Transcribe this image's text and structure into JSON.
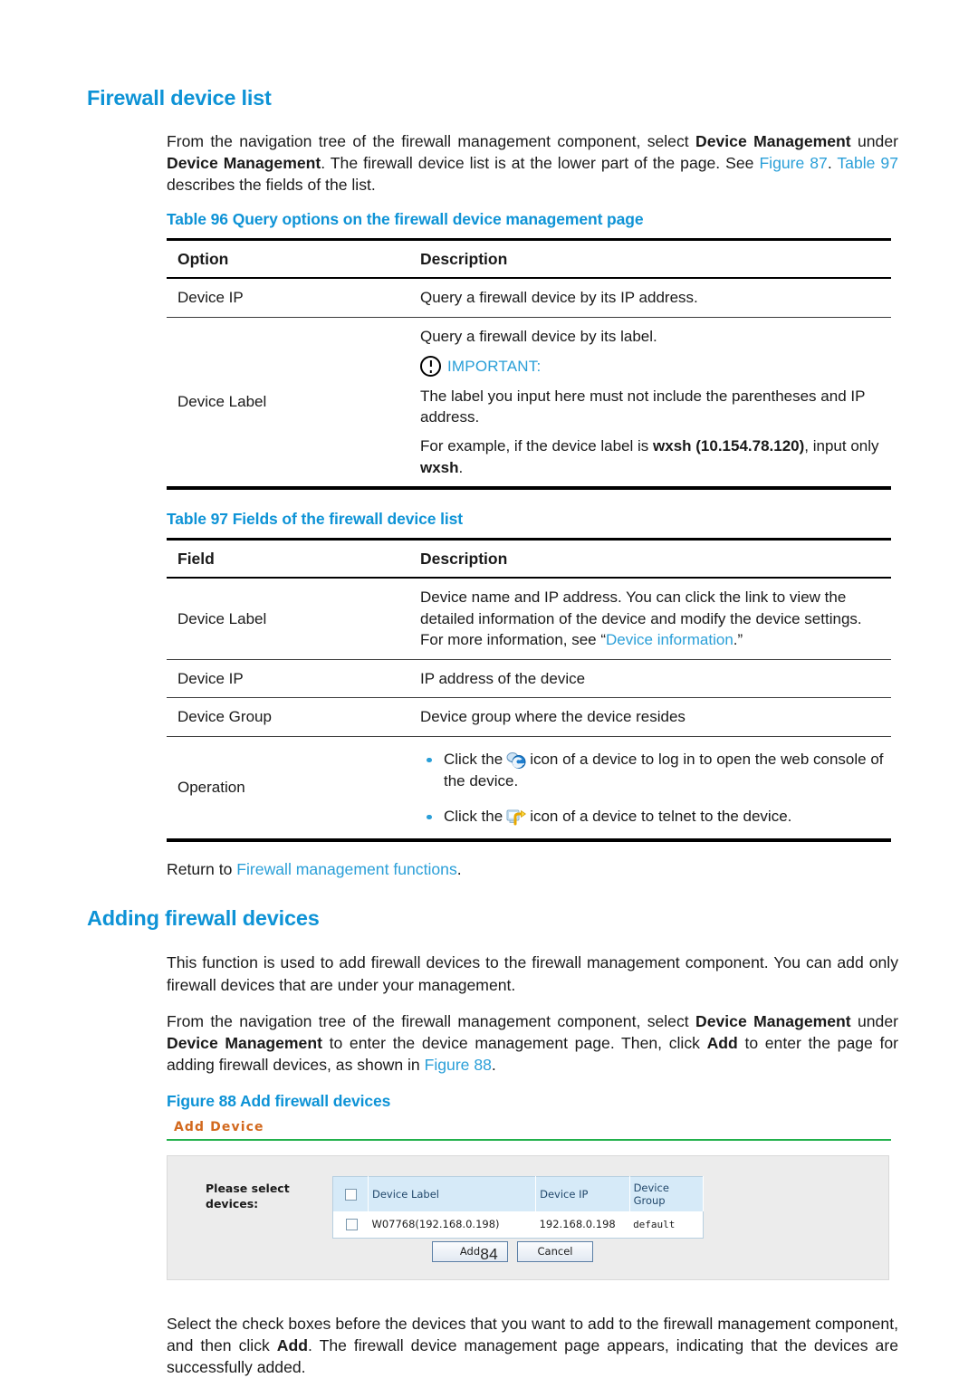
{
  "doc": {
    "page_number": "84",
    "accent_blue": "#0e93d6",
    "link_blue": "#2a9fd8"
  },
  "section1": {
    "heading": "Firewall device list",
    "intro": {
      "p1_a": "From the navigation tree of the firewall management component, select ",
      "p1_b": "Device Management",
      "p1_c": " under ",
      "p1_d": "Device Management",
      "p1_e": ". The firewall device list is at the lower part of the page. See ",
      "p1_link1": "Figure 87",
      "p1_f": ". ",
      "p1_link2": "Table 97",
      "p1_g": " describes the fields of the list."
    }
  },
  "table96": {
    "caption": "Table 96 Query options on the firewall device management page",
    "headers": [
      "Option",
      "Description"
    ],
    "rows": [
      {
        "option": "Device IP",
        "description": "Query a firewall device by its IP address."
      },
      {
        "option": "Device Label",
        "description_line1": "Query a firewall device by its label.",
        "important_label": "IMPORTANT:",
        "important_line1": "The label you input here must not include the parentheses and IP address.",
        "important_line2_a": "For example, if the device label is ",
        "important_line2_b": "wxsh (10.154.78.120)",
        "important_line2_c": ", input only ",
        "important_line2_d": "wxsh",
        "important_line2_e": "."
      }
    ]
  },
  "table97": {
    "caption": "Table 97 Fields of the firewall device list",
    "headers": [
      "Field",
      "Description"
    ],
    "rows": [
      {
        "field": "Device Label",
        "desc_a": "Device name and IP address. You can click the link to view the detailed information of the device and modify the device settings. For more information, see “",
        "desc_link": "Device information",
        "desc_b": ".”"
      },
      {
        "field": "Device IP",
        "desc": "IP address of the device"
      },
      {
        "field": "Device Group",
        "desc": "Device group where the device resides"
      },
      {
        "field": "Operation",
        "bullets": [
          {
            "before": "Click the",
            "icon": "web-console-icon",
            "after": "icon of a device to log in to open the web console of the device."
          },
          {
            "before": "Click the",
            "icon": "telnet-icon",
            "after": "icon of a device to telnet to the device."
          }
        ]
      }
    ]
  },
  "return_line": {
    "prefix": "Return to ",
    "link": "Firewall management functions",
    "suffix": "."
  },
  "section2": {
    "heading": "Adding firewall devices",
    "p1": "This function is used to add firewall devices to the firewall management component. You can add only firewall devices that are under your management.",
    "p2_a": "From the navigation tree of the firewall management component, select ",
    "p2_b": "Device Management",
    "p2_c": " under ",
    "p2_d": "Device Management",
    "p2_e": " to enter the device management page. Then, click ",
    "p2_f": "Add",
    "p2_g": " to enter the page for adding firewall devices, as shown in ",
    "p2_link": "Figure 88",
    "p2_h": "."
  },
  "figure88": {
    "caption": "Figure 88 Add firewall devices",
    "screenshot": {
      "title": "Add Device",
      "title_color": "#d2691e",
      "rule_color": "#22b14c",
      "select_label": "Please select devices:",
      "table": {
        "headers": [
          "Device Label",
          "Device IP",
          "Device Group"
        ],
        "rows": [
          {
            "device_label": "W07768(192.168.0.198)",
            "device_ip": "192.168.0.198",
            "device_group": "default",
            "checked": false
          }
        ],
        "header_checked": false
      },
      "buttons": [
        {
          "label": "Add"
        },
        {
          "label": "Cancel"
        }
      ]
    }
  },
  "closing": {
    "p_a": "Select the check boxes before the devices that you want to add to the firewall management component, and then click ",
    "p_b": "Add",
    "p_c": ". The firewall device management page appears, indicating that the devices are successfully added."
  }
}
